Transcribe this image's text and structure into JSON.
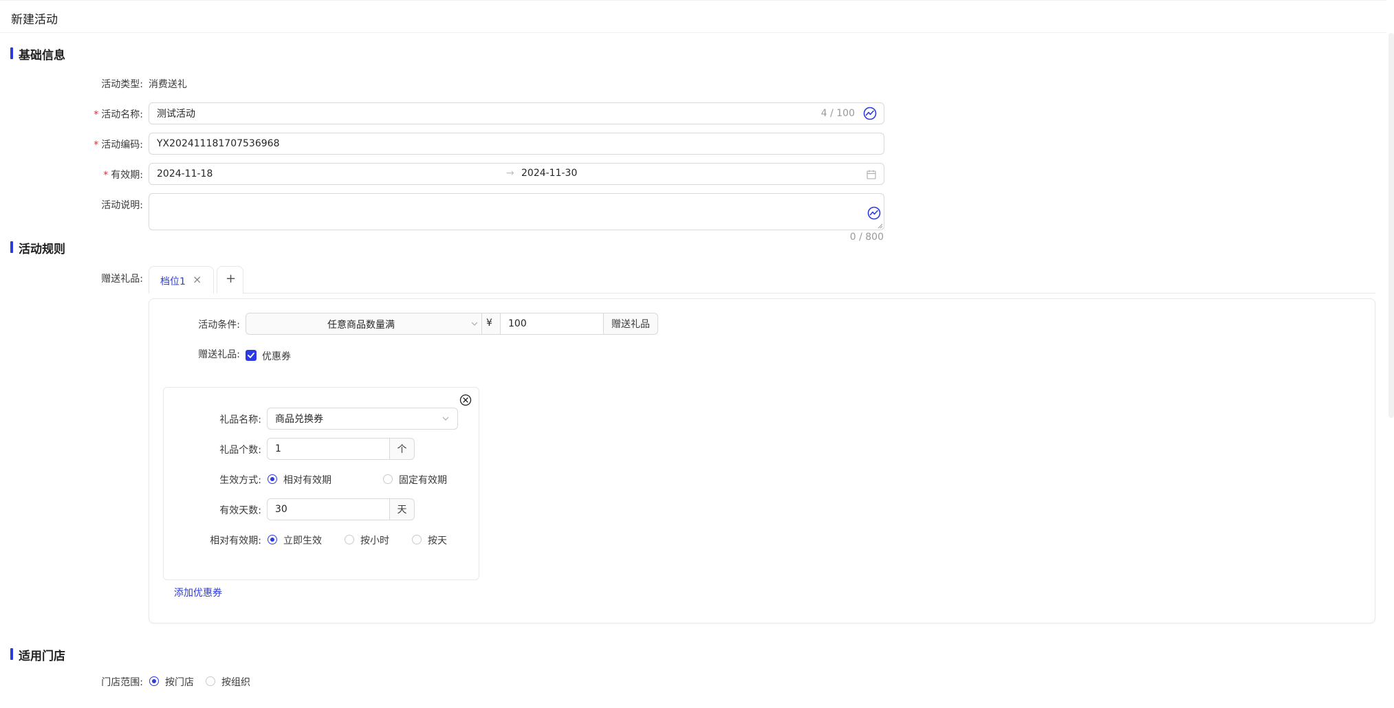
{
  "header": {
    "title": "新建活动"
  },
  "sections": {
    "basic": "基础信息",
    "rules": "活动规则",
    "stores": "适用门店"
  },
  "basic": {
    "type_label": "活动类型:",
    "type_value": "消费送礼",
    "name_label": "活动名称:",
    "name_value": "测试活动",
    "name_counter": "4 / 100",
    "code_label": "活动编码:",
    "code_value": "YX202411181707536968",
    "period_label": "有效期:",
    "period_start": "2024-11-18",
    "period_arrow": "→",
    "period_end": "2024-11-30",
    "desc_label": "活动说明:",
    "desc_value": "",
    "desc_counter": "0 / 800"
  },
  "rules": {
    "gift_label": "赠送礼品:",
    "tabs": [
      {
        "label": "档位1",
        "close": "×"
      }
    ],
    "add_tab": "+",
    "condition_label": "活动条件:",
    "condition_select": "任意商品数量满",
    "currency": "¥",
    "condition_amount": "100",
    "condition_suffix": "赠送礼品",
    "gift_type_label": "赠送礼品:",
    "gift_type_option": "优惠券",
    "gift_type_checked": true,
    "coupon": {
      "name_label": "礼品名称:",
      "name_value": "商品兑换券",
      "count_label": "礼品个数:",
      "count_value": "1",
      "count_unit": "个",
      "effect_label": "生效方式:",
      "effect_options": [
        "相对有效期",
        "固定有效期"
      ],
      "effect_selected": 0,
      "days_label": "有效天数:",
      "days_value": "30",
      "days_unit": "天",
      "relative_label": "相对有效期:",
      "relative_options": [
        "立即生效",
        "按小时",
        "按天"
      ],
      "relative_selected": 0
    },
    "add_coupon": "添加优惠券"
  },
  "stores": {
    "scope_label": "门店范围:",
    "scope_options": [
      "按门店",
      "按组织"
    ],
    "scope_selected": 0
  },
  "colors": {
    "accent": "#2c3be0",
    "required": "#f5222d",
    "border": "#d9d9d9"
  },
  "icons": [
    "ai-assist-icon",
    "calendar-icon",
    "chevron-down-icon",
    "close-icon",
    "close-circle-icon",
    "check-icon",
    "plus-icon",
    "resize-handle-icon"
  ]
}
